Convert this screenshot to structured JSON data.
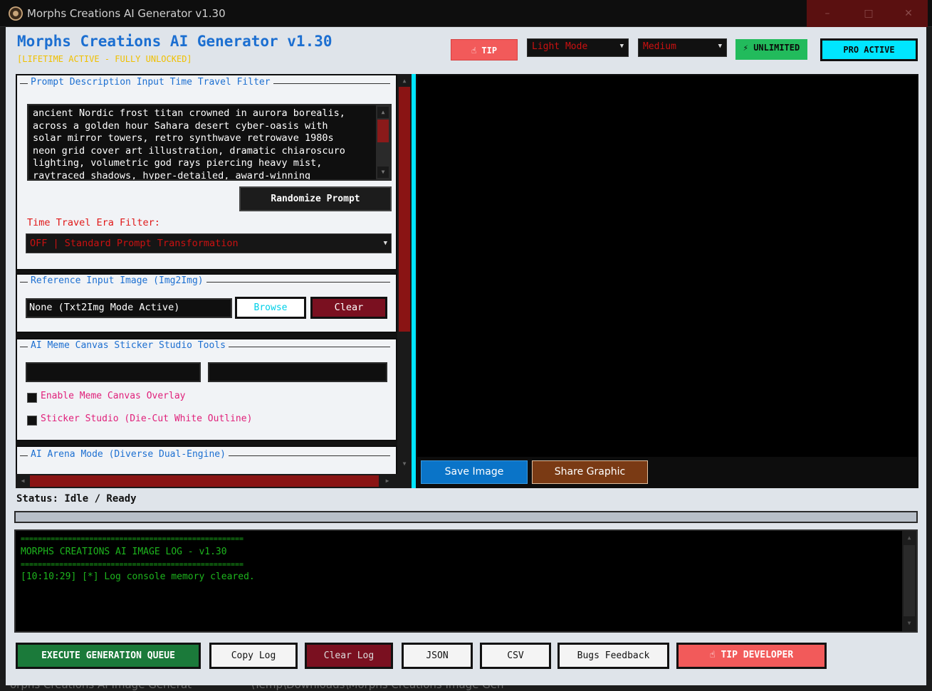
{
  "window": {
    "title": "Morphs Creations AI Generator v1.30",
    "controls": {
      "minimize": "–",
      "maximize": "□",
      "close": "✕"
    }
  },
  "header": {
    "title": "Morphs Creations AI Generator v1.30",
    "subtitle": "[LIFETIME ACTIVE - FULLY UNLOCKED]",
    "tip_label": "☝ TIP",
    "theme_select": "Light Mode",
    "quality_select": "Medium",
    "unlimited_label": "⚡ UNLIMITED",
    "pro_label": "PRO ACTIVE"
  },
  "prompt_panel": {
    "legend": "Prompt Description Input  Time Travel Filter",
    "prompt_text": "ancient Nordic frost titan crowned in aurora borealis,\nacross a golden hour Sahara desert cyber-oasis with\nsolar mirror towers, retro synthwave retrowave 1980s\nneon grid cover art illustration, dramatic chiaroscuro\nlighting, volumetric god rays piercing heavy mist,\nraytraced shadows, hyper-detailed, award-winning",
    "randomize_label": "Randomize Prompt",
    "era_label": "Time Travel Era Filter:",
    "era_value": "OFF | Standard Prompt Transformation"
  },
  "reference_panel": {
    "legend": "Reference Input Image (Img2Img)",
    "value": "None (Txt2Img Mode Active)",
    "browse_label": "Browse",
    "clear_label": "Clear"
  },
  "meme_panel": {
    "legend": "AI Meme Canvas Sticker Studio Tools",
    "overlay_label": "Enable Meme Canvas Overlay",
    "sticker_label": "Sticker Studio (Die-Cut White Outline)"
  },
  "arena_panel": {
    "legend": "AI Arena Mode (Diverse Dual-Engine)"
  },
  "preview": {
    "save_label": "Save Image",
    "share_label": "Share Graphic"
  },
  "status": {
    "text": "Status: Idle / Ready"
  },
  "log": {
    "lines": [
      "====================================================",
      "MORPHS CREATIONS AI IMAGE LOG - v1.30",
      "====================================================",
      "[10:10:29] [*] Log console memory cleared."
    ]
  },
  "footer": {
    "execute_label": "EXECUTE GENERATION QUEUE",
    "copy_label": "Copy Log",
    "clear_label": "Clear Log",
    "json_label": "JSON",
    "csv_label": "CSV",
    "bugs_label": "Bugs Feedback",
    "tip_label": "☝ TIP DEVELOPER"
  },
  "taskbar_behind": {
    "left": "orphs Creations AI Image Generat",
    "right": "\\Temp\\Downloads\\Morphs Creations Image Gen"
  },
  "colors": {
    "accent_blue": "#1c6fd1",
    "cyan": "#00e5ff",
    "log_green": "#1db51d",
    "execute_green": "#1b7a3a",
    "tip_red": "#f25a5a",
    "dark_red": "#7a1020",
    "share_brown": "#7a3a14",
    "save_blue": "#0a74c8"
  }
}
